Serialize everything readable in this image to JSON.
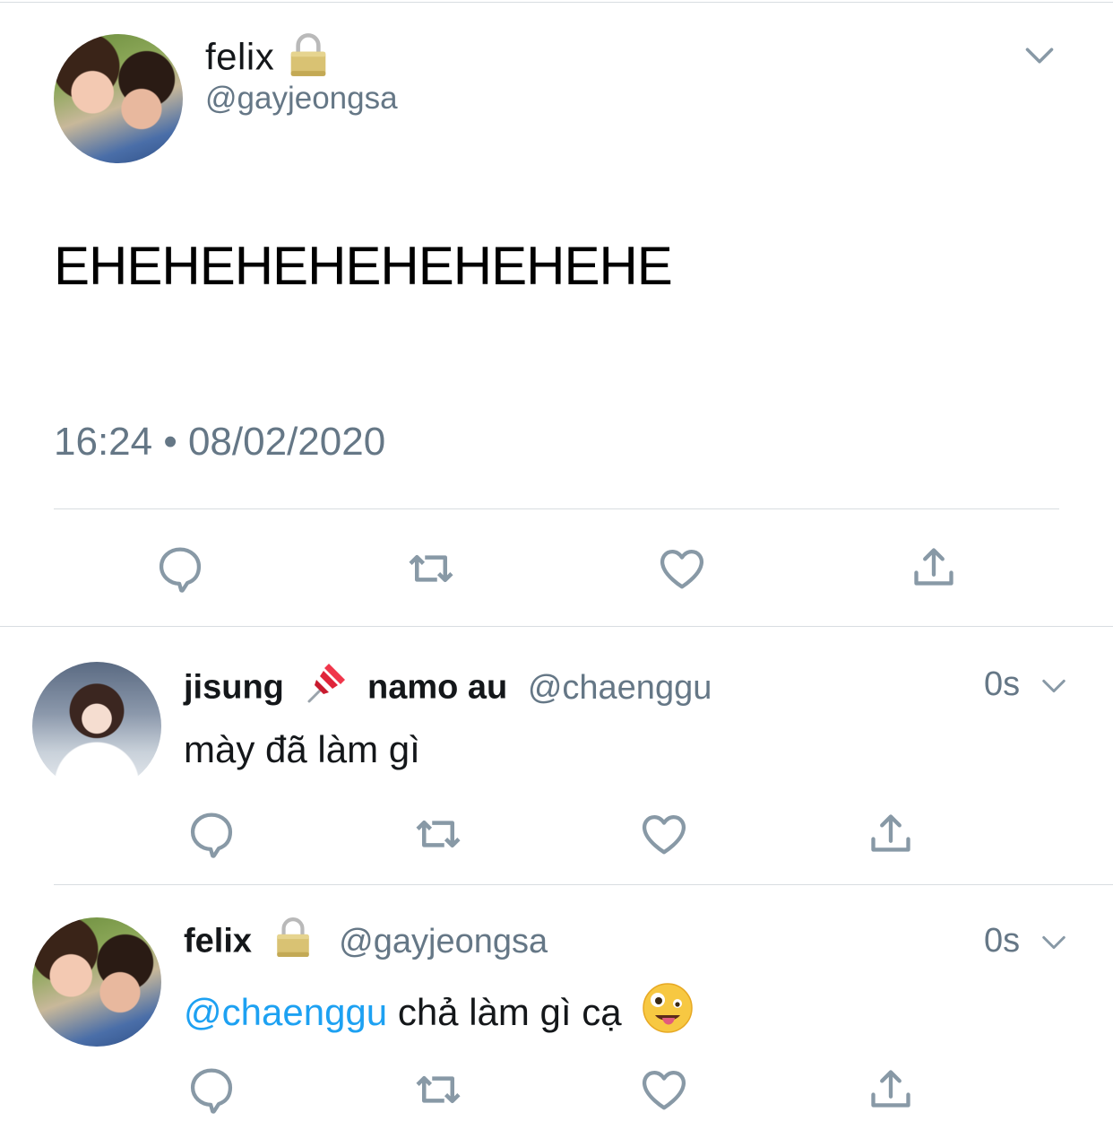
{
  "main_tweet": {
    "author_name": "felix",
    "author_handle": "@gayjeongsa",
    "text": "EHEHEHEHEHEHEHEHE",
    "timestamp": "16:24 • 08/02/2020",
    "icons": {
      "protected": "lock-icon",
      "menu": "chevron-down-icon"
    }
  },
  "replies": [
    {
      "author_name": "jisung",
      "author_name_suffix": "namo au",
      "author_emoji": "pushpin-icon",
      "author_handle": "@chaenggu",
      "time": "0s",
      "text": "mày đã làm gì"
    },
    {
      "author_name": "felix",
      "author_handle": "@gayjeongsa",
      "time": "0s",
      "mention": "@chaenggu",
      "text": " chả làm gì cạ",
      "emoji": "zany-face-icon"
    }
  ],
  "action_icons": [
    "reply-icon",
    "retweet-icon",
    "like-icon",
    "share-icon"
  ],
  "colors": {
    "mention": "#1da1f2",
    "secondary_text": "#657786",
    "icon": "#8899a6",
    "divider": "#d8dde1"
  }
}
